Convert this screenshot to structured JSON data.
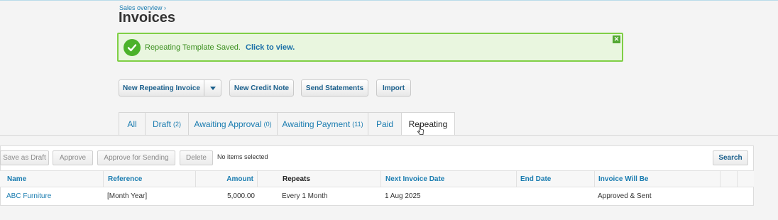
{
  "breadcrumb": "Sales overview ›",
  "page_title": "Invoices",
  "notice": {
    "message": "Repeating Template Saved.",
    "link": "Click to view.",
    "close": "✕"
  },
  "actions": {
    "new_repeating": "New Repeating Invoice",
    "new_credit_note": "New Credit Note",
    "send_statements": "Send Statements",
    "import": "Import"
  },
  "tabs": [
    {
      "label": "All",
      "count": ""
    },
    {
      "label": "Draft",
      "count": "(2)"
    },
    {
      "label": "Awaiting Approval",
      "count": "(0)"
    },
    {
      "label": "Awaiting Payment",
      "count": "(11)"
    },
    {
      "label": "Paid",
      "count": ""
    },
    {
      "label": "Repeating",
      "count": ""
    }
  ],
  "active_tab": "Repeating",
  "toolbar": {
    "save_as_draft": "Save as Draft",
    "approve": "Approve",
    "approve_for_sending": "Approve for Sending",
    "delete": "Delete",
    "no_items": "No items selected",
    "search": "Search"
  },
  "table": {
    "columns": [
      "Name",
      "Reference",
      "Amount",
      "Repeats",
      "Next Invoice Date",
      "End Date",
      "Invoice Will Be"
    ],
    "rows": [
      [
        "ABC Furniture",
        "[Month Year]",
        "5,000.00",
        "Every 1 Month",
        "1 Aug 2025",
        "",
        "Approved & Sent"
      ]
    ]
  },
  "colors": {
    "link": "#1a7cb0",
    "success_border": "#7fcf45",
    "success_bg": "#e9f6df"
  }
}
